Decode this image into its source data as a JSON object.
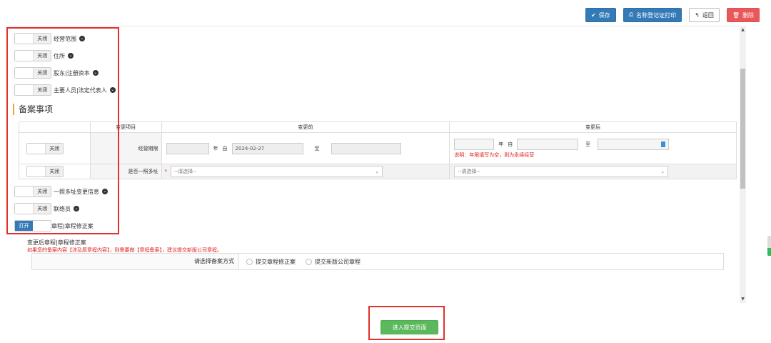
{
  "toolbar": {
    "save": "保存",
    "print": "名称登记证打印",
    "back": "返回",
    "delete": "删除"
  },
  "toggles": {
    "off_label": "关闭",
    "on_label": "打开",
    "scope": "经营范围",
    "address": "住所",
    "shareholder": "股东|注册资本",
    "personnel": "主要人员|法定代表人",
    "multi_address": "一照多址变更信息",
    "liaison": "联络员",
    "charter": "章程|章程修正案"
  },
  "section": {
    "title": "备案事项"
  },
  "table": {
    "headers": [
      "变更项目",
      "变更前",
      "变更后"
    ],
    "row1": {
      "item": "经营期限",
      "before_year_unit": "年",
      "before_from": "自",
      "before_date": "2024-02-27",
      "before_to": "至",
      "after_year_unit": "年",
      "after_from": "自",
      "after_to": "至",
      "after_note": "说明：年限填写为空，则为永续经营"
    },
    "row2": {
      "item": "是否一照多址",
      "required_mark": "*",
      "before_select": "--请选择--",
      "after_select": "--请选择--"
    }
  },
  "after": {
    "title": "变更后章程|章程修正案",
    "note": "如果您的备案内容【涉及原章程内容】，则需要做【章程备案】，建议提交新版公司章程。",
    "method_label": "请选择备案方式",
    "option1": "提交章程修正案",
    "option2": "提交新版公司章程"
  },
  "submit": "进入提交页面",
  "colors": {
    "primary": "#337ab7",
    "danger": "#e9575a",
    "success": "#5cb85c",
    "highlight": "#e0322b"
  }
}
